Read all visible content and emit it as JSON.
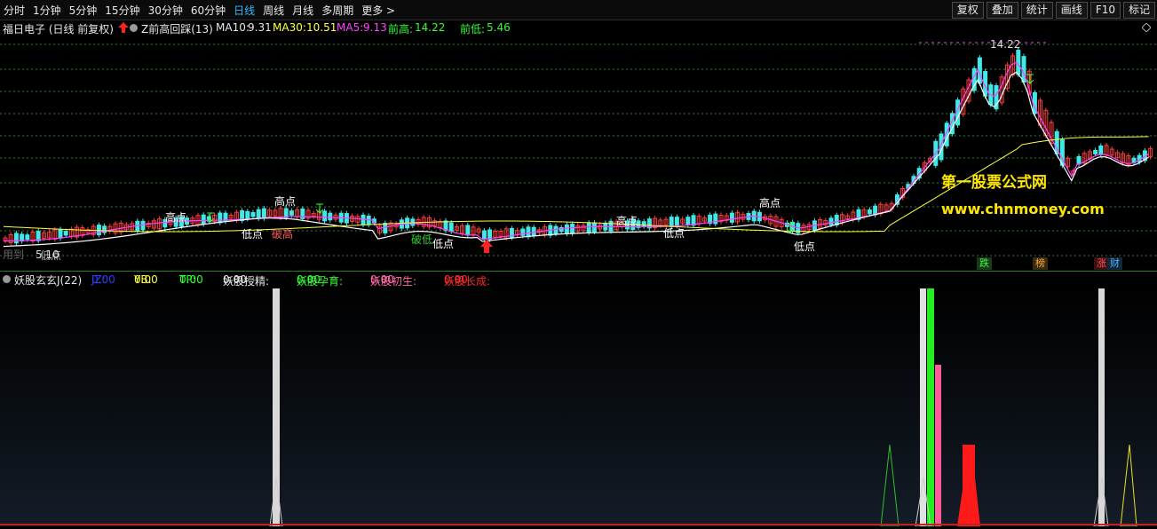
{
  "toolbar": {
    "periods": [
      "分时",
      "1分钟",
      "5分钟",
      "15分钟",
      "30分钟",
      "60分钟",
      "日线",
      "周线",
      "月线",
      "多周期",
      "更多 >"
    ],
    "active_period": "日线",
    "tools": [
      "复权",
      "叠加",
      "统计",
      "画线",
      "F10",
      "标记"
    ]
  },
  "stock": {
    "name": "福日电子 (日线 前复权)",
    "formula": "Z前高回踩(13)",
    "ma10_label": "MA10:",
    "ma10": "9.31",
    "ma30_label": "MA30:",
    "ma30": "10.51",
    "ma5_label": "MA5:",
    "ma5": "9.13",
    "prev_high_label": "前高:",
    "prev_high": "14.22",
    "prev_low_label": "前低:",
    "prev_low": "5.46"
  },
  "chart_labels": {
    "high_marker": "14.22",
    "low_marker": "5.10",
    "faded_text": "用到",
    "high_points": [
      "高点",
      "高点",
      "高点",
      "高点"
    ],
    "low_points": [
      "低点",
      "低点",
      "低点",
      "低点",
      "低点"
    ],
    "break_high": "破高",
    "break_low": "破低"
  },
  "watermark": {
    "title": "第一股票公式网",
    "url": "www.chnmoney.com"
  },
  "badges": [
    "跌",
    "榜",
    "涨",
    "财"
  ],
  "indicator": {
    "name": "妖股玄玄J(22)",
    "items": [
      {
        "label": "JZ:",
        "value": "0.00",
        "color": "#2a3cff"
      },
      {
        "label": "YB:",
        "value": "0.00",
        "color": "#ffff40"
      },
      {
        "label": "TP:",
        "value": "0.00",
        "color": "#30ff30"
      },
      {
        "label": "妖股授精:",
        "value": "0.00",
        "color": "#e8e8e8"
      },
      {
        "label": "妖股孕育:",
        "value": "0.00",
        "color": "#30ff30"
      },
      {
        "label": "妖股初生:",
        "value": "0.00",
        "color": "#ff6aa8"
      },
      {
        "label": "妖股长成:",
        "value": "0.00",
        "color": "#ff2a2a"
      }
    ]
  },
  "colors": {
    "up": "#ff3a3a",
    "down": "#40e8e8",
    "ma5": "#ffffff",
    "ma10": "#ffff40",
    "ma30": "#ff40ff",
    "grid": "#2f7f2f",
    "accent": "#35b8ff"
  }
}
